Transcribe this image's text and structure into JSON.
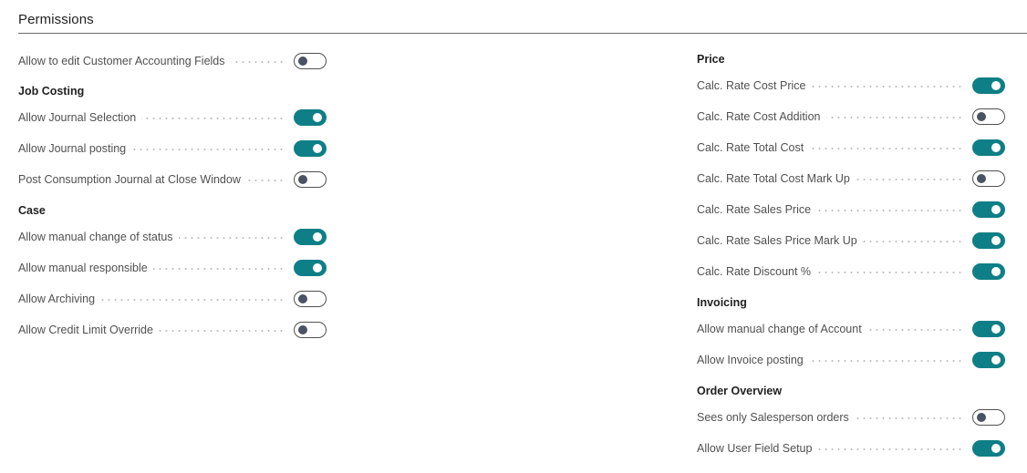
{
  "section": {
    "title": "Permissions"
  },
  "left": {
    "top_field": {
      "label": "Allow to edit Customer Accounting Fields",
      "on": false
    },
    "job_costing": {
      "title": "Job Costing",
      "fields": [
        {
          "label": "Allow Journal Selection",
          "on": true
        },
        {
          "label": "Allow Journal posting",
          "on": true
        },
        {
          "label": "Post Consumption Journal at Close Window",
          "on": false
        }
      ]
    },
    "case": {
      "title": "Case",
      "fields": [
        {
          "label": "Allow manual change of status",
          "on": true
        },
        {
          "label": "Allow manual responsible",
          "on": true
        },
        {
          "label": "Allow Archiving",
          "on": false
        },
        {
          "label": "Allow Credit Limit Override",
          "on": false
        }
      ]
    }
  },
  "right": {
    "price": {
      "title": "Price",
      "fields": [
        {
          "label": "Calc. Rate Cost Price",
          "on": true
        },
        {
          "label": "Calc. Rate Cost Addition",
          "on": false
        },
        {
          "label": "Calc. Rate Total Cost",
          "on": true
        },
        {
          "label": "Calc. Rate Total Cost Mark Up",
          "on": false
        },
        {
          "label": "Calc. Rate Sales Price",
          "on": true
        },
        {
          "label": "Calc. Rate Sales Price Mark Up",
          "on": true
        },
        {
          "label": "Calc. Rate Discount %",
          "on": true
        }
      ]
    },
    "invoicing": {
      "title": "Invoicing",
      "fields": [
        {
          "label": "Allow manual change of Account",
          "on": true
        },
        {
          "label": "Allow Invoice posting",
          "on": true
        }
      ]
    },
    "order_overview": {
      "title": "Order Overview",
      "fields": [
        {
          "label": "Sees only Salesperson orders",
          "on": false
        },
        {
          "label": "Allow User Field Setup",
          "on": true
        }
      ]
    }
  },
  "colors": {
    "accent": "#0e7f86",
    "toggle_off_knob": "#4a5361"
  }
}
